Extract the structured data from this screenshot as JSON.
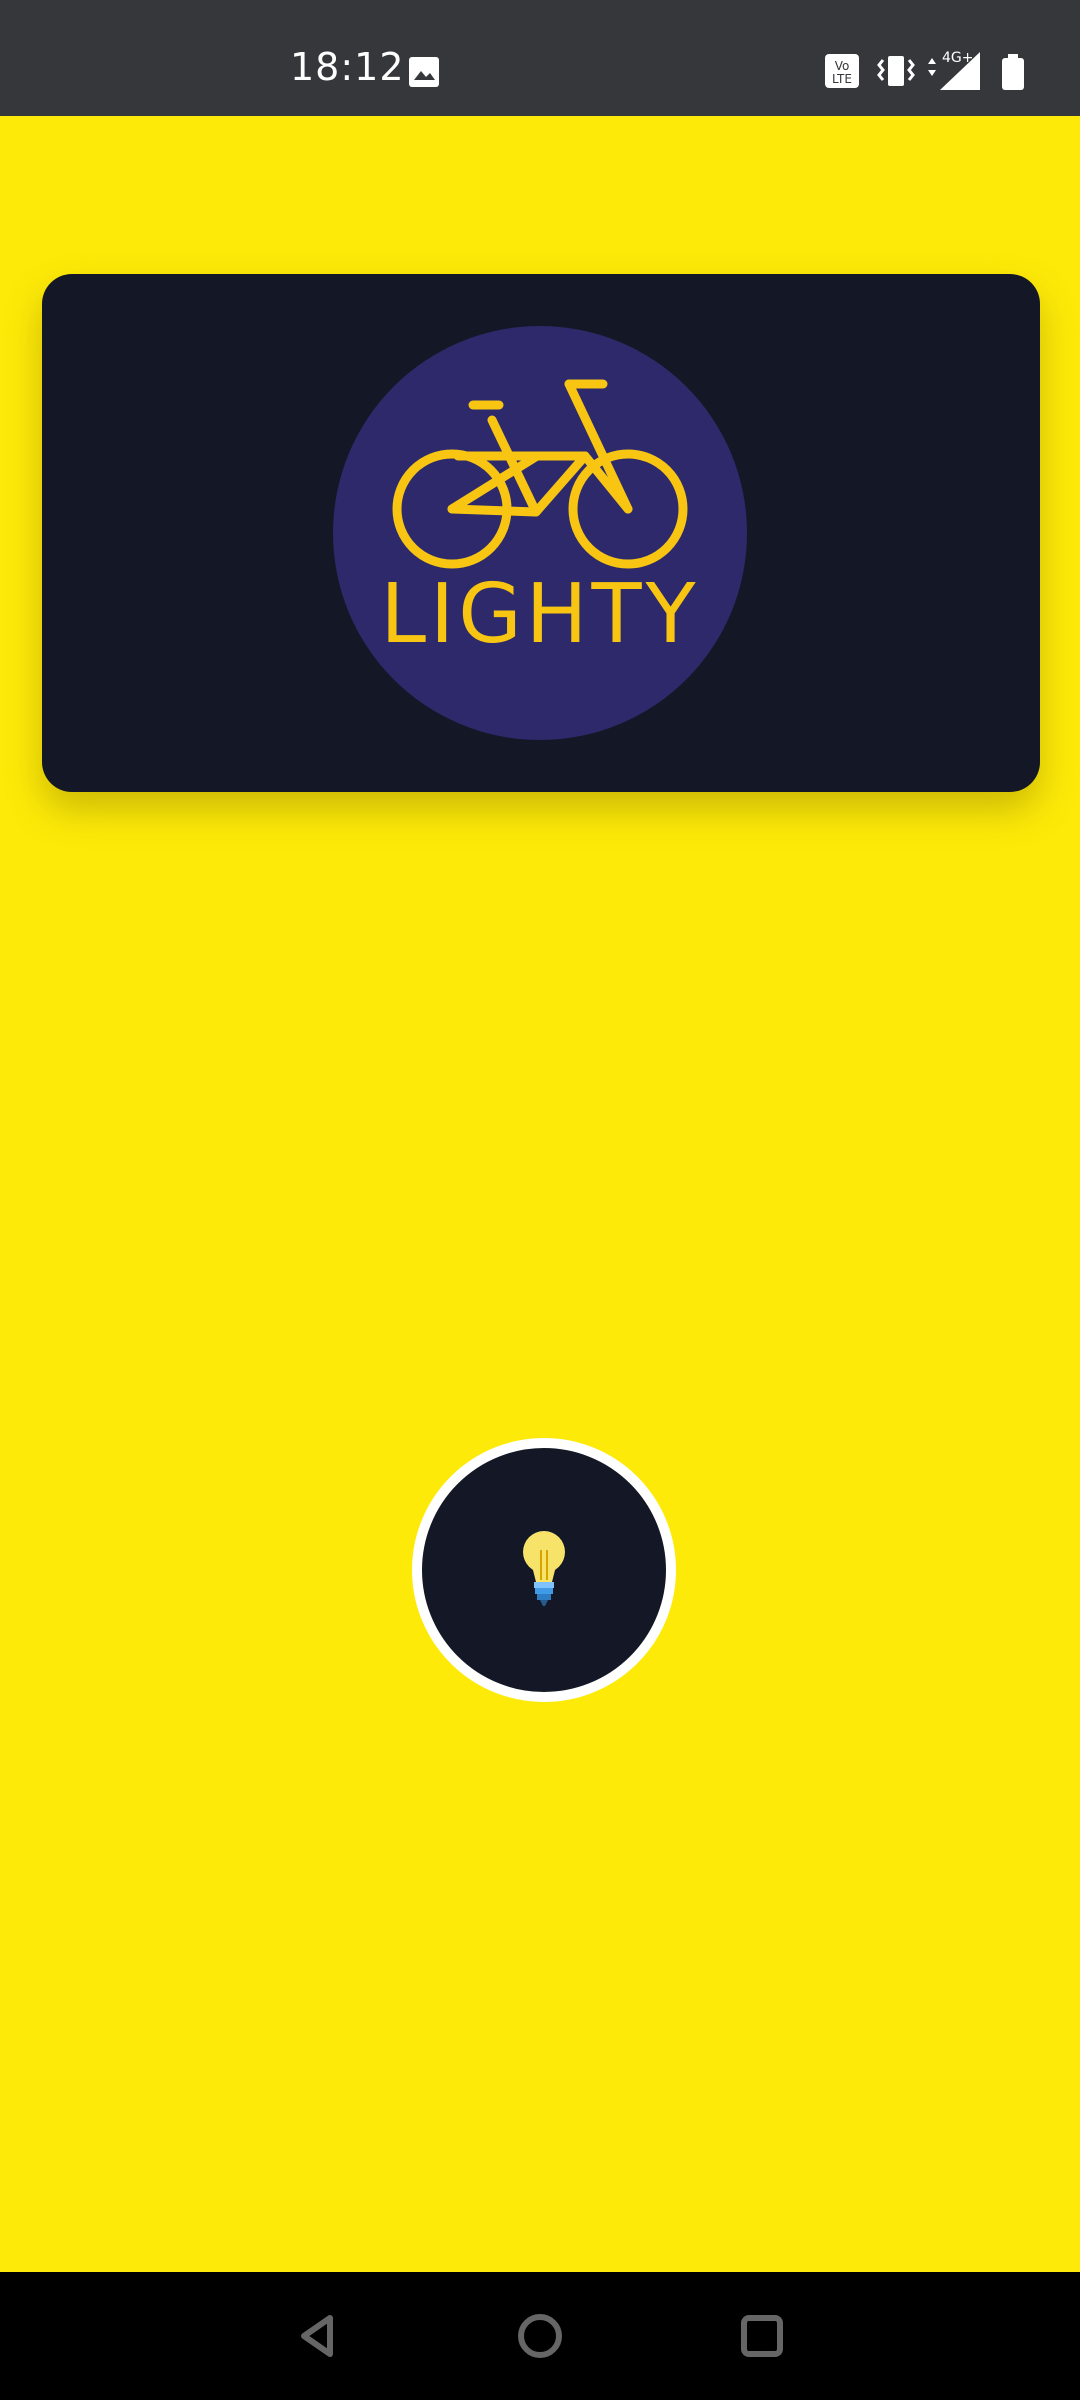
{
  "status_bar": {
    "time": "18:12",
    "icons": [
      "gallery-icon",
      "volte-icon",
      "vibrate-icon",
      "signal-4g-plus-icon",
      "battery-icon"
    ],
    "network_label": "4G+"
  },
  "app": {
    "logo_text": "LIGHTY",
    "background_color": "#FDEA08",
    "card_color": "#141826",
    "logo_circle_color": "#2D296B",
    "logo_accent_color": "#F7C512",
    "light_button_icon": "lightbulb-icon"
  },
  "navigation_bar": {
    "buttons": [
      "back-icon",
      "home-icon",
      "recents-icon"
    ]
  }
}
